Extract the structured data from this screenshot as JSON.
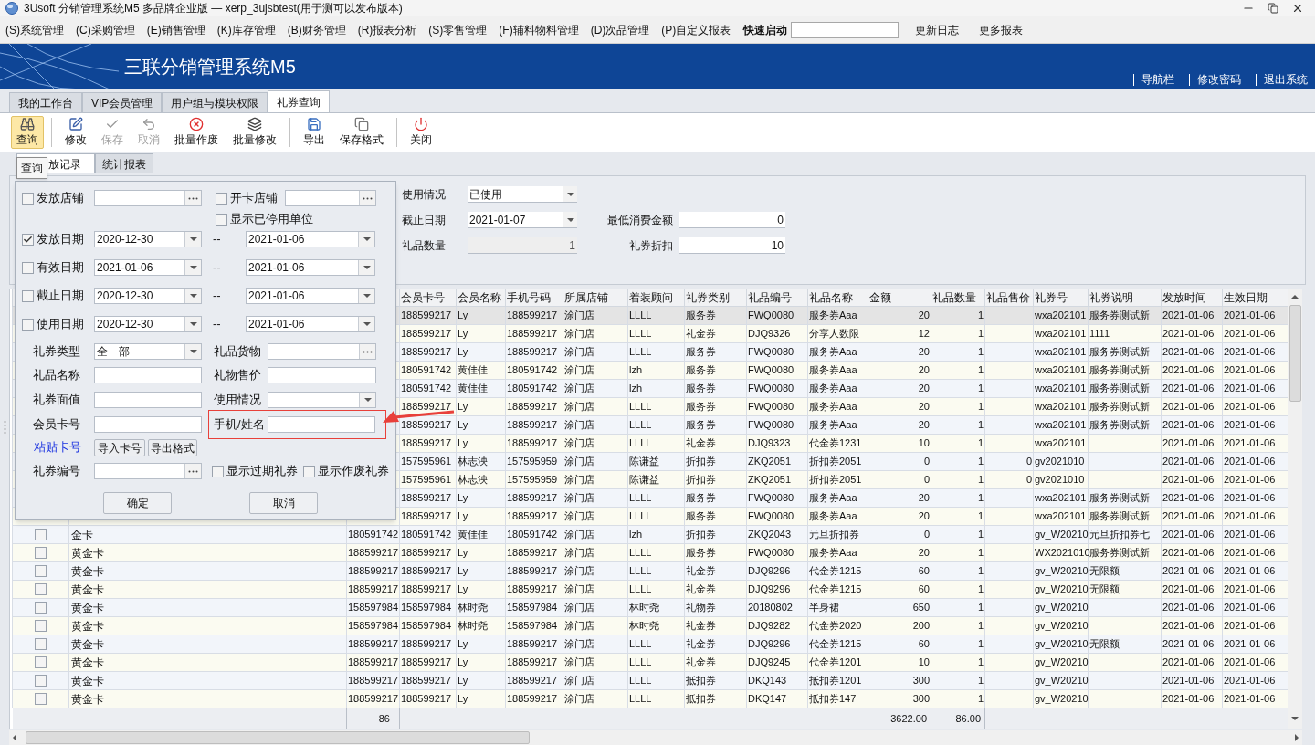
{
  "window": {
    "title": "3Usoft 分销管理系统M5 多品牌企业版 — xerp_3ujsbtest(用于测可以发布版本)"
  },
  "menu": {
    "items": [
      "(S)系统管理",
      "(C)采购管理",
      "(E)销售管理",
      "(K)库存管理",
      "(B)财务管理",
      "(R)报表分析",
      "(S)零售管理",
      "(F)辅料物料管理",
      "(D)次品管理",
      "(P)自定义报表"
    ],
    "quick_launch": {
      "label": "快速启动"
    },
    "links": [
      "更新日志",
      "更多报表"
    ]
  },
  "banner": {
    "title": "三联分销管理系统M5",
    "links": [
      "导航栏",
      "修改密码",
      "退出系统"
    ]
  },
  "tabs": [
    {
      "label": "我的工作台",
      "selected": false
    },
    {
      "label": "VIP会员管理",
      "selected": false
    },
    {
      "label": "用户组与模块权限",
      "selected": false
    },
    {
      "label": "礼券查询",
      "selected": true
    }
  ],
  "toolbar": [
    {
      "label": "查询",
      "active": true,
      "disabled": false,
      "separator_after": true
    },
    {
      "label": "修改",
      "active": false,
      "disabled": false,
      "separator_after": false
    },
    {
      "label": "保存",
      "active": false,
      "disabled": true,
      "separator_after": false
    },
    {
      "label": "取消",
      "active": false,
      "disabled": true,
      "separator_after": false
    },
    {
      "label": "批量作废",
      "active": false,
      "disabled": false,
      "separator_after": false
    },
    {
      "label": "批量修改",
      "active": false,
      "disabled": false,
      "separator_after": true
    },
    {
      "label": "导出",
      "active": false,
      "disabled": false,
      "separator_after": false
    },
    {
      "label": "保存格式",
      "active": false,
      "disabled": false,
      "separator_after": true
    },
    {
      "label": "关闭",
      "active": false,
      "disabled": false,
      "separator_after": false
    }
  ],
  "tooltip": "查询",
  "subtabs": [
    {
      "label": "放记录",
      "selected": true
    },
    {
      "label": "统计报表",
      "selected": false
    }
  ],
  "filters": {
    "left": [
      {
        "kind": "select",
        "label": "使用情况",
        "value": "已使用",
        "disabled": false
      },
      {
        "kind": "select",
        "label": "截止日期",
        "value": "2021-01-07",
        "disabled": false
      },
      {
        "kind": "number",
        "label": "礼品数量",
        "value": "1",
        "disabled": true
      }
    ],
    "right": [
      {
        "kind": "number",
        "label": "最低消费金额",
        "value": "0",
        "disabled": false
      },
      {
        "kind": "number",
        "label": "礼券折扣",
        "value": "10",
        "disabled": false
      }
    ]
  },
  "query_popup": {
    "issue_store": {
      "label": "发放店铺",
      "checked": false
    },
    "card_store": {
      "label": "开卡店铺",
      "checked": false
    },
    "show_disabled": {
      "label": "显示已停用单位",
      "checked": false
    },
    "date_ranges": [
      {
        "label": "发放日期",
        "checked": true,
        "from": "2020-12-30",
        "sep": "--",
        "to": "2021-01-06"
      },
      {
        "label": "有效日期",
        "checked": false,
        "from": "2021-01-06",
        "sep": "--",
        "to": "2021-01-06"
      },
      {
        "label": "截止日期",
        "checked": false,
        "from": "2020-12-30",
        "sep": "--",
        "to": "2021-01-06"
      },
      {
        "label": "使用日期",
        "checked": false,
        "from": "2020-12-30",
        "sep": "--",
        "to": "2021-01-06"
      }
    ],
    "coupon_type": {
      "label": "礼券类型",
      "value": "全　部"
    },
    "gift_goods": {
      "label": "礼品货物"
    },
    "gift_name": {
      "label": "礼品名称"
    },
    "gift_price": {
      "label": "礼物售价"
    },
    "face_value": {
      "label": "礼券面值"
    },
    "usage": {
      "label": "使用情况"
    },
    "card_no": {
      "label": "会员卡号"
    },
    "phone_name": {
      "label": "手机/姓名",
      "highlighted": true
    },
    "paste_link": "粘贴卡号",
    "import_button": "导入卡号",
    "export_button": "导出格式",
    "coupon_no": {
      "label": "礼券编号"
    },
    "show_expired": {
      "label": "显示过期礼券",
      "checked": false
    },
    "show_void": {
      "label": "显示作废礼券",
      "checked": false
    },
    "ok": "确定",
    "cancel": "取消"
  },
  "table": {
    "columns": [
      "会员卡号",
      "会员名称",
      "手机号码",
      "所属店铺",
      "着装顾问",
      "礼券类别",
      "礼品编号",
      "礼品名称",
      "金额",
      "礼品数量",
      "礼品售价",
      "礼券号",
      "礼券说明",
      "发放时间",
      "生效日期"
    ],
    "rows": [
      {
        "selected": true,
        "card": "188599217",
        "name": "Ly",
        "phone": "188599217",
        "store": "涂门店",
        "advisor": "LLLL",
        "category": "服务券",
        "code": "FWQ0080",
        "gift": "服务券Aaa",
        "amount": "20",
        "qty": "1",
        "coupon_no": "wxa202101",
        "note": "服务券测试新",
        "issued": "2021-01-06",
        "effective": "2021-01-06"
      },
      {
        "selected": false,
        "card": "188599217",
        "name": "Ly",
        "phone": "188599217",
        "store": "涂门店",
        "advisor": "LLLL",
        "category": "礼金券",
        "code": "DJQ9326",
        "gift": "分享人数限",
        "amount": "12",
        "qty": "1",
        "coupon_no": "wxa202101",
        "note": "1111",
        "issued": "2021-01-06",
        "effective": "2021-01-06"
      },
      {
        "selected": false,
        "card": "188599217",
        "name": "Ly",
        "phone": "188599217",
        "store": "涂门店",
        "advisor": "LLLL",
        "category": "服务券",
        "code": "FWQ0080",
        "gift": "服务券Aaa",
        "amount": "20",
        "qty": "1",
        "coupon_no": "wxa202101",
        "note": "服务券测试新",
        "issued": "2021-01-06",
        "effective": "2021-01-06"
      },
      {
        "selected": false,
        "card": "180591742",
        "name": "黄佳佳",
        "phone": "180591742",
        "store": "涂门店",
        "advisor": "lzh",
        "category": "服务券",
        "code": "FWQ0080",
        "gift": "服务券Aaa",
        "amount": "20",
        "qty": "1",
        "coupon_no": "wxa202101",
        "note": "服务券测试新",
        "issued": "2021-01-06",
        "effective": "2021-01-06"
      },
      {
        "selected": false,
        "card": "180591742",
        "name": "黄佳佳",
        "phone": "180591742",
        "store": "涂门店",
        "advisor": "lzh",
        "category": "服务券",
        "code": "FWQ0080",
        "gift": "服务券Aaa",
        "amount": "20",
        "qty": "1",
        "coupon_no": "wxa202101",
        "note": "服务券测试新",
        "issued": "2021-01-06",
        "effective": "2021-01-06"
      },
      {
        "selected": false,
        "card": "188599217",
        "name": "Ly",
        "phone": "188599217",
        "store": "涂门店",
        "advisor": "LLLL",
        "category": "服务券",
        "code": "FWQ0080",
        "gift": "服务券Aaa",
        "amount": "20",
        "qty": "1",
        "coupon_no": "wxa202101",
        "note": "服务券测试新",
        "issued": "2021-01-06",
        "effective": "2021-01-06"
      },
      {
        "selected": false,
        "card": "188599217",
        "name": "Ly",
        "phone": "188599217",
        "store": "涂门店",
        "advisor": "LLLL",
        "category": "服务券",
        "code": "FWQ0080",
        "gift": "服务券Aaa",
        "amount": "20",
        "qty": "1",
        "coupon_no": "wxa202101",
        "note": "服务券测试新",
        "issued": "2021-01-06",
        "effective": "2021-01-06"
      },
      {
        "selected": false,
        "card": "188599217",
        "name": "Ly",
        "phone": "188599217",
        "store": "涂门店",
        "advisor": "LLLL",
        "category": "礼金券",
        "code": "DJQ9323",
        "gift": "代金券1231",
        "amount": "10",
        "qty": "1",
        "coupon_no": "wxa202101",
        "issued": "2021-01-06",
        "effective": "2021-01-06"
      },
      {
        "selected": false,
        "card": "157595961",
        "name": "林志泱",
        "phone": "157595959",
        "store": "涂门店",
        "advisor": "陈谦益",
        "category": "折扣券",
        "code": "ZKQ2051",
        "gift": "折扣券2051",
        "amount": "0",
        "qty": "1",
        "price": "0",
        "coupon_no": "gv2021010",
        "issued": "2021-01-06",
        "effective": "2021-01-06"
      },
      {
        "selected": false,
        "card": "157595961",
        "name": "林志泱",
        "phone": "157595959",
        "store": "涂门店",
        "advisor": "陈谦益",
        "category": "折扣券",
        "code": "ZKQ2051",
        "gift": "折扣券2051",
        "amount": "0",
        "qty": "1",
        "price": "0",
        "coupon_no": "gv2021010",
        "issued": "2021-01-06",
        "effective": "2021-01-06"
      },
      {
        "selected": false,
        "card": "188599217",
        "name": "Ly",
        "phone": "188599217",
        "store": "涂门店",
        "advisor": "LLLL",
        "category": "服务券",
        "code": "FWQ0080",
        "gift": "服务券Aaa",
        "amount": "20",
        "qty": "1",
        "coupon_no": "wxa202101",
        "note": "服务券测试新",
        "issued": "2021-01-06",
        "effective": "2021-01-06"
      },
      {
        "selected": false,
        "card": "188599217",
        "name": "Ly",
        "phone": "188599217",
        "store": "涂门店",
        "advisor": "LLLL",
        "category": "服务券",
        "code": "FWQ0080",
        "gift": "服务券Aaa",
        "amount": "20",
        "qty": "1",
        "coupon_no": "wxa202101",
        "note": "服务券测试新",
        "issued": "2021-01-06",
        "effective": "2021-01-06"
      },
      {
        "selected": false,
        "checked": false,
        "card_type": "金卡",
        "column_3": "180591742",
        "card": "180591742",
        "name": "黄佳佳",
        "phone": "180591742",
        "store": "涂门店",
        "advisor": "lzh",
        "category": "折扣券",
        "code": "ZKQ2043",
        "gift": "元旦折扣券",
        "amount": "0",
        "qty": "1",
        "coupon_no": "gv_W20210",
        "note": "元旦折扣券七",
        "issued": "2021-01-06",
        "effective": "2021-01-06"
      },
      {
        "selected": false,
        "checked": false,
        "card_type": "黄金卡",
        "column_3": "188599217",
        "card": "188599217",
        "name": "Ly",
        "phone": "188599217",
        "store": "涂门店",
        "advisor": "LLLL",
        "category": "服务券",
        "code": "FWQ0080",
        "gift": "服务券Aaa",
        "amount": "20",
        "qty": "1",
        "coupon_no": "WX2021010",
        "note": "服务券测试新",
        "issued": "2021-01-06",
        "effective": "2021-01-06"
      },
      {
        "selected": false,
        "checked": false,
        "card_type": "黄金卡",
        "column_3": "188599217",
        "card": "188599217",
        "name": "Ly",
        "phone": "188599217",
        "store": "涂门店",
        "advisor": "LLLL",
        "category": "礼金券",
        "code": "DJQ9296",
        "gift": "代金券1215",
        "amount": "60",
        "qty": "1",
        "coupon_no": "gv_W20210",
        "note": "无限额",
        "issued": "2021-01-06",
        "effective": "2021-01-06"
      },
      {
        "selected": false,
        "checked": false,
        "card_type": "黄金卡",
        "column_3": "188599217",
        "card": "188599217",
        "name": "Ly",
        "phone": "188599217",
        "store": "涂门店",
        "advisor": "LLLL",
        "category": "礼金券",
        "code": "DJQ9296",
        "gift": "代金券1215",
        "amount": "60",
        "qty": "1",
        "coupon_no": "gv_W20210",
        "note": "无限额",
        "issued": "2021-01-06",
        "effective": "2021-01-06"
      },
      {
        "selected": false,
        "checked": false,
        "card_type": "黄金卡",
        "column_3": "158597984",
        "card": "158597984",
        "name": "林时尧",
        "phone": "158597984",
        "store": "涂门店",
        "advisor": "林时尧",
        "category": "礼物券",
        "code": "20180802",
        "gift": "半身裙",
        "amount": "650",
        "qty": "1",
        "coupon_no": "gv_W20210",
        "issued": "2021-01-06",
        "effective": "2021-01-06"
      },
      {
        "selected": false,
        "checked": false,
        "card_type": "黄金卡",
        "column_3": "158597984",
        "card": "158597984",
        "name": "林时尧",
        "phone": "158597984",
        "store": "涂门店",
        "advisor": "林时尧",
        "category": "礼金券",
        "code": "DJQ9282",
        "gift": "代金券2020",
        "amount": "200",
        "qty": "1",
        "coupon_no": "gv_W20210",
        "issued": "2021-01-06",
        "effective": "2021-01-06"
      },
      {
        "selected": false,
        "checked": false,
        "card_type": "黄金卡",
        "column_3": "188599217",
        "card": "188599217",
        "name": "Ly",
        "phone": "188599217",
        "store": "涂门店",
        "advisor": "LLLL",
        "category": "礼金券",
        "code": "DJQ9296",
        "gift": "代金券1215",
        "amount": "60",
        "qty": "1",
        "coupon_no": "gv_W20210",
        "note": "无限额",
        "issued": "2021-01-06",
        "effective": "2021-01-06"
      },
      {
        "selected": false,
        "checked": false,
        "card_type": "黄金卡",
        "column_3": "188599217",
        "card": "188599217",
        "name": "Ly",
        "phone": "188599217",
        "store": "涂门店",
        "advisor": "LLLL",
        "category": "礼金券",
        "code": "DJQ9245",
        "gift": "代金券1201",
        "amount": "10",
        "qty": "1",
        "coupon_no": "gv_W20210",
        "issued": "2021-01-06",
        "effective": "2021-01-06"
      },
      {
        "selected": false,
        "checked": false,
        "card_type": "黄金卡",
        "column_3": "188599217",
        "card": "188599217",
        "name": "Ly",
        "phone": "188599217",
        "store": "涂门店",
        "advisor": "LLLL",
        "category": "抵扣券",
        "code": "DKQ143",
        "gift": "抵扣券1201",
        "amount": "300",
        "qty": "1",
        "coupon_no": "gv_W20210",
        "issued": "2021-01-06",
        "effective": "2021-01-06"
      },
      {
        "selected": false,
        "checked": false,
        "card_type": "黄金卡",
        "column_3": "188599217",
        "card": "188599217",
        "name": "Ly",
        "phone": "188599217",
        "store": "涂门店",
        "advisor": "LLLL",
        "category": "抵扣券",
        "code": "DKQ147",
        "gift": "抵扣券147",
        "amount": "300",
        "qty": "1",
        "coupon_no": "gv_W20210",
        "issued": "2021-01-06",
        "effective": "2021-01-06"
      }
    ],
    "footer": {
      "count": "86",
      "amount": "3622.00",
      "qty": "86.00"
    }
  }
}
